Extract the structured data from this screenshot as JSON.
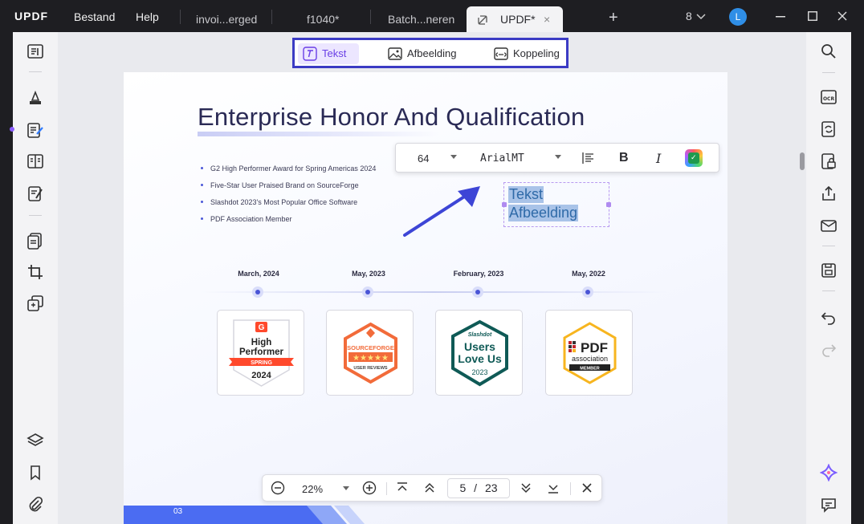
{
  "app": {
    "logo": "UPDF",
    "menu": {
      "file": "Bestand",
      "help": "Help"
    },
    "tabs": [
      {
        "label": "invoi...erged"
      },
      {
        "label": "f1040*"
      },
      {
        "label": "Batch...neren"
      },
      {
        "label": "UPDF*",
        "active": true
      }
    ],
    "tab_count": "8",
    "user_initial": "L",
    "icons": {
      "tab_close": "×",
      "new_tab": "+"
    }
  },
  "edit_toolbar": {
    "text_label": "Tekst",
    "image_label": "Afbeelding",
    "link_label": "Koppeling",
    "active": "text",
    "border_color": "#3b3bc4",
    "active_color": "#6a3fe6"
  },
  "format_bar": {
    "font_size": "64",
    "font_name": "ArialMT",
    "bold_label": "B",
    "italic_label": "I",
    "color_check": "✓"
  },
  "selected_text": {
    "line1": "Tekst",
    "line2": "Afbeelding"
  },
  "page": {
    "title": "Enterprise Honor And Qualification",
    "bullets": [
      "G2 High Performer Award for Spring Americas 2024",
      "Five-Star User Praised Brand on SourceForge",
      "Slashdot 2023's Most Popular Office Software",
      "PDF Association Member"
    ],
    "timeline": [
      {
        "date": "March, 2024"
      },
      {
        "date": "May, 2023"
      },
      {
        "date": "February, 2023"
      },
      {
        "date": "May, 2022"
      }
    ],
    "badges": {
      "g2": {
        "logo": "G",
        "line1": "High",
        "line2": "Performer",
        "ribbon": "SPRING",
        "year": "2024"
      },
      "sourceforge": {
        "brand": "SOURCEFORGE",
        "stars": "★★★★★",
        "caption": "USER REVIEWS"
      },
      "slashdot": {
        "brand": "Slashdot",
        "line1": "Users",
        "line2": "Love Us",
        "year": "2023"
      },
      "pdfa": {
        "line1": "PDF",
        "line2": "association",
        "line3": "MEMBER"
      }
    },
    "footer_number": "03"
  },
  "bottom_nav": {
    "zoom": "22%",
    "current_page": "5",
    "separator": "/",
    "total_pages": "23"
  }
}
